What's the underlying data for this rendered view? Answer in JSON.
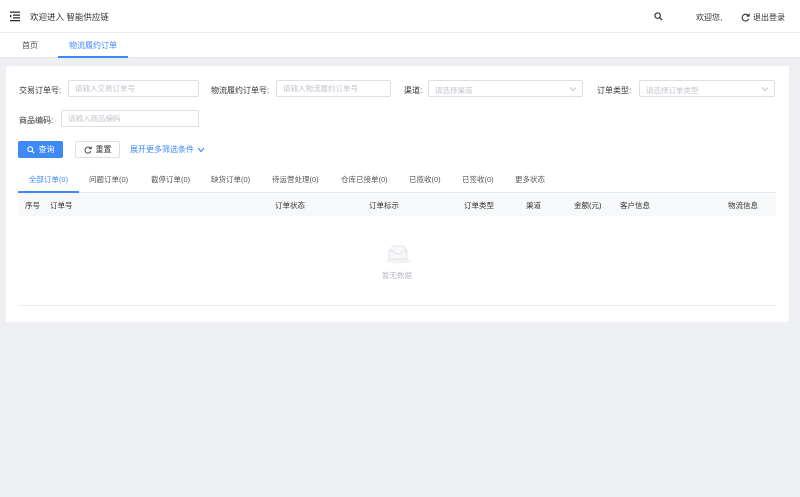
{
  "header": {
    "title": "欢迎进入 智能供应链",
    "welcome": "欢迎您,",
    "logout_label": "退出登录"
  },
  "page_tabs": [
    {
      "label": "首页",
      "active": false
    },
    {
      "label": "物流履约订单",
      "active": true
    }
  ],
  "filters": {
    "trade_order_label": "交易订单号:",
    "trade_order_placeholder": "请输入交易订单号",
    "logistics_order_label": "物流履约订单号:",
    "logistics_order_placeholder": "请输入物流履约订单号",
    "channel_label": "渠道:",
    "channel_placeholder": "请选择渠道",
    "order_type_label": "订单类型:",
    "order_type_placeholder": "请选择订单类型",
    "product_code_label": "商品编码:",
    "product_code_placeholder": "请输入商品编码"
  },
  "actions": {
    "query_label": "查询",
    "reset_label": "重置",
    "expand_label": "展开更多筛选条件"
  },
  "status_tabs": [
    {
      "label": "全部订单(0)",
      "active": true
    },
    {
      "label": "问题订单(0)",
      "active": false
    },
    {
      "label": "截停订单(0)",
      "active": false
    },
    {
      "label": "缺货订单(0)",
      "active": false
    },
    {
      "label": "待运营处理(0)",
      "active": false
    },
    {
      "label": "仓库已接单(0)",
      "active": false
    },
    {
      "label": "已揽收(0)",
      "active": false
    },
    {
      "label": "已签收(0)",
      "active": false
    },
    {
      "label": "更多状态",
      "active": false
    }
  ],
  "table": {
    "columns": [
      "序号",
      "订单号",
      "订单状态",
      "订单标示",
      "订单类型",
      "渠道",
      "金额(元)",
      "客户信息",
      "物流信息"
    ],
    "rows": [],
    "empty_text": "暂无数据"
  },
  "colors": {
    "accent": "#3d8af7",
    "background": "#edeff2",
    "header_row": "#f7f8fa"
  }
}
